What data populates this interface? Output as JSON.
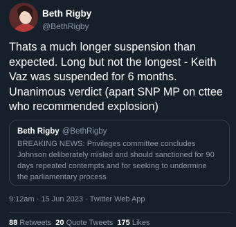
{
  "author": {
    "name": "Beth Rigby",
    "handle": "@BethRigby"
  },
  "tweet": {
    "text": "Thats a much longer suspension than\nexpected. Long but not the longest - Keith\nVaz was suspended for 6 months.\nUnanimous verdict (apart SNP MP on cttee\nwho recommended explosion)"
  },
  "quote": {
    "name": "Beth Rigby",
    "handle": "@BethRigby",
    "text": "BREAKING NEWS: Privileges committee concludes\nJohnson deliberately misled and should sanctioned for 90\ndays repeated contempts and for seeking to undermine\nthe parliamentary process"
  },
  "meta": {
    "time": "9:12am",
    "separator1": " · ",
    "date": "15 Jun 2023",
    "separator2": " · ",
    "app": "Twitter Web App"
  },
  "stats": {
    "retweets": "88",
    "retweets_label": " Retweets",
    "quotes": "20",
    "quotes_label": " Quote Tweets",
    "likes": "175",
    "likes_label": " Likes"
  }
}
